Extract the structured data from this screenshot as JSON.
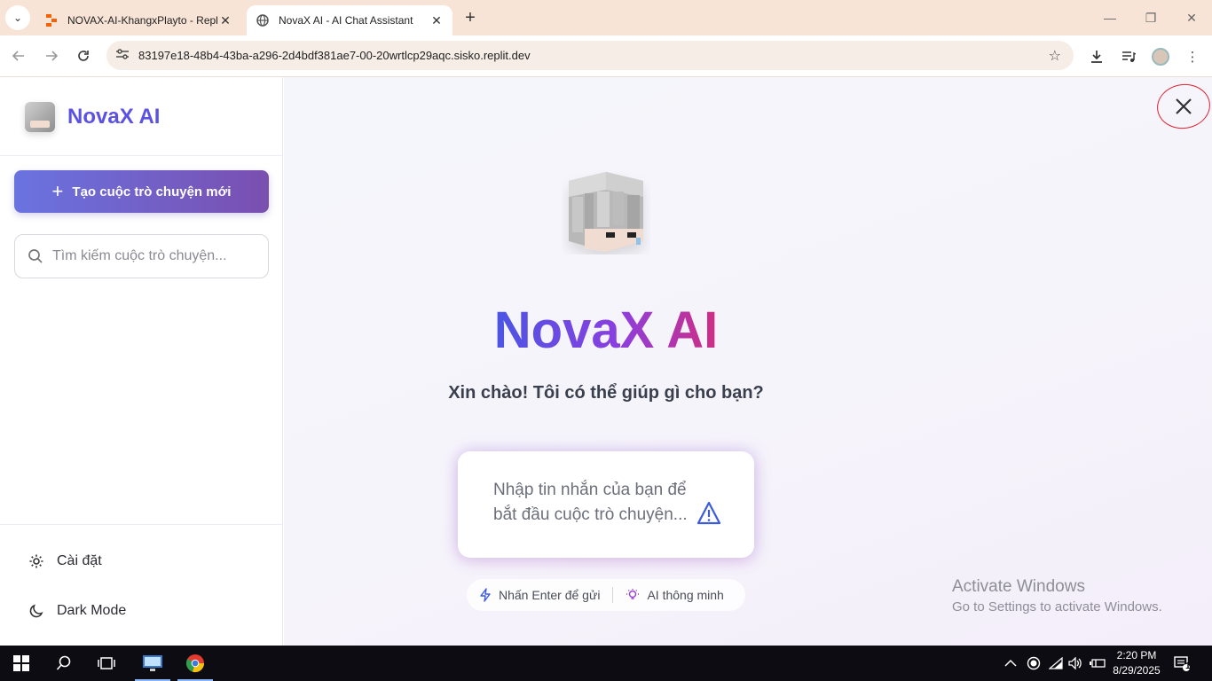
{
  "browser": {
    "tabs": [
      {
        "title": "NOVAX-AI-KhangxPlayto - Repl",
        "favicon": "replit-icon",
        "active": false
      },
      {
        "title": "NovaX AI - AI Chat Assistant",
        "favicon": "globe-icon",
        "active": true
      }
    ],
    "url": "83197e18-48b4-43ba-a296-2d4bdf381ae7-00-20wrtlcp29aqc.sisko.replit.dev"
  },
  "sidebar": {
    "brand": "NovaX AI",
    "new_chat_label": "Tạo cuộc trò chuyện mới",
    "search_placeholder": "Tìm kiếm cuộc trò chuyện...",
    "footer": [
      {
        "label": "Cài đặt",
        "icon": "gear-icon"
      },
      {
        "label": "Dark Mode",
        "icon": "moon-icon"
      }
    ]
  },
  "main": {
    "title": "NovaX AI",
    "subtitle": "Xin chào! Tôi có thể giúp gì cho bạn?",
    "composer_placeholder": "Nhập tin nhắn của bạn để bắt đầu cuộc trò chuyện...",
    "hints": [
      {
        "label": "Nhấn Enter để gửi",
        "icon": "lightning-icon"
      },
      {
        "label": "AI thông minh",
        "icon": "lightbulb-icon"
      }
    ]
  },
  "watermark": {
    "line1": "Activate Windows",
    "line2": "Go to Settings to activate Windows."
  },
  "taskbar": {
    "time": "2:20 PM",
    "date": "8/29/2025",
    "notification_count": "1"
  },
  "colors": {
    "brand_gradient_start": "#4a55e4",
    "brand_gradient_mid": "#8a3fe0",
    "brand_gradient_end": "#d12d82",
    "new_chat_button": "#6a73e0",
    "annotation_circle": "#e02030"
  }
}
